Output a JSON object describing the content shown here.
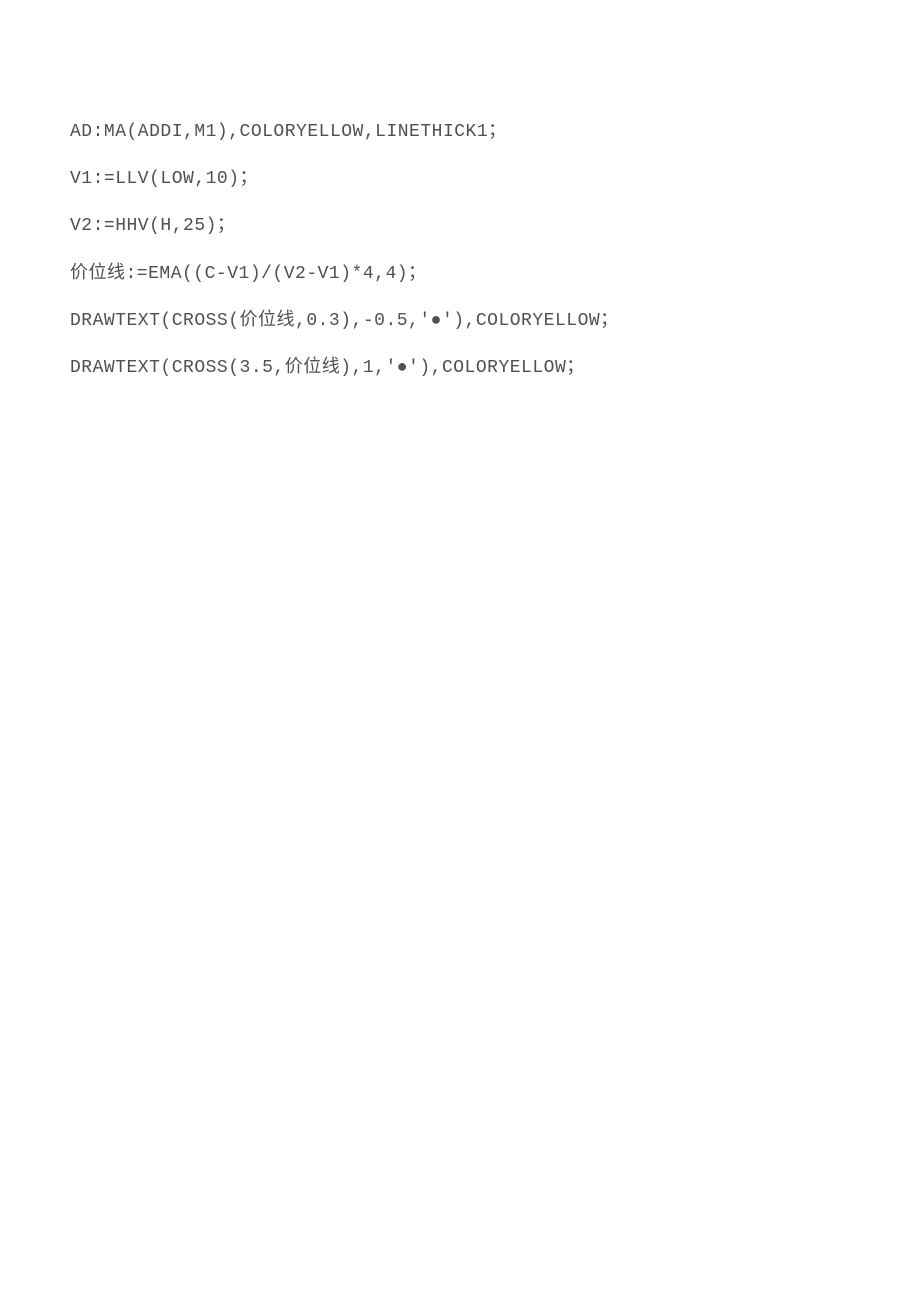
{
  "lines": [
    "AD:MA(ADDI,M1),COLORYELLOW,LINETHICK1；",
    "V1:=LLV(LOW,10)；",
    "V2:=HHV(H,25)；",
    "价位线:=EMA((C-V1)/(V2-V1)*4,4)；",
    "DRAWTEXT(CROSS(价位线,0.3),-0.5,'●'),COLORYELLOW；",
    "DRAWTEXT(CROSS(3.5,价位线),1,'●'),COLORYELLOW；"
  ]
}
